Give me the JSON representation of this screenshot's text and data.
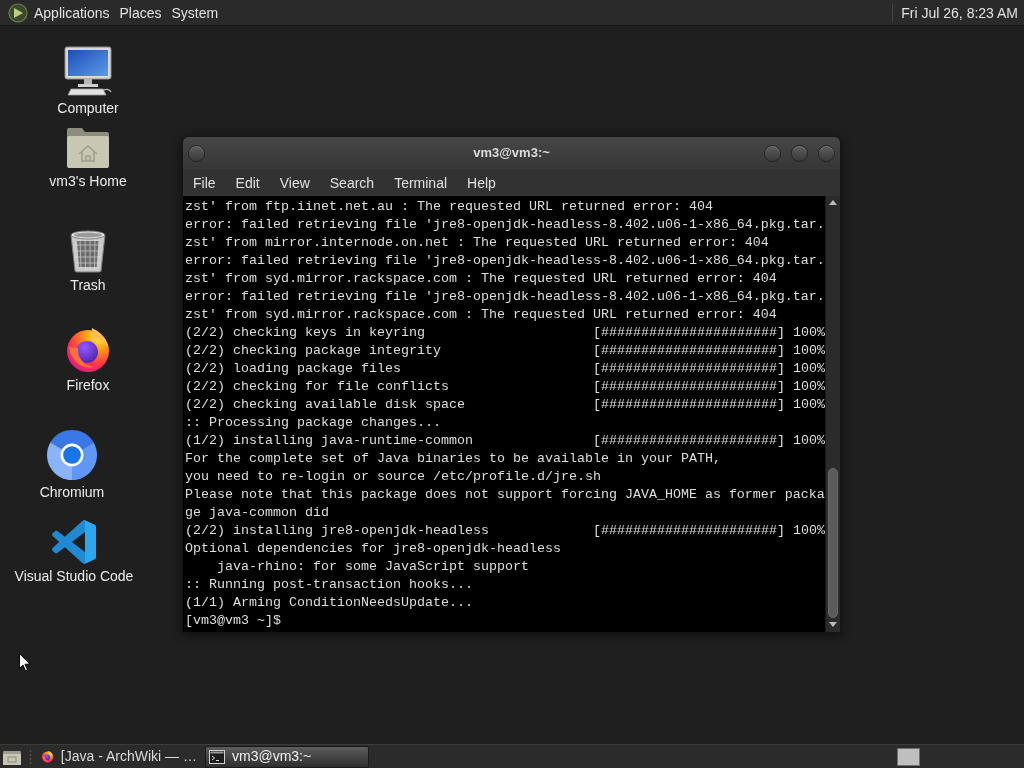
{
  "top_panel": {
    "menus": [
      "Applications",
      "Places",
      "System"
    ],
    "clock": "Fri Jul 26, 8:23 AM"
  },
  "desktop_icons": [
    {
      "kind": "computer",
      "label": "Computer"
    },
    {
      "kind": "home",
      "label": "vm3's Home"
    },
    {
      "kind": "trash",
      "label": "Trash"
    },
    {
      "kind": "firefox",
      "label": "Firefox"
    },
    {
      "kind": "chromium",
      "label": "Chromium"
    },
    {
      "kind": "vscode",
      "label": "Visual Studio Code"
    }
  ],
  "terminal": {
    "title": "vm3@vm3:~",
    "menu": [
      "File",
      "Edit",
      "View",
      "Search",
      "Terminal",
      "Help"
    ],
    "lines": [
      {
        "kind": "output",
        "text": "zst' from ftp.iinet.net.au : The requested URL returned error: 404"
      },
      {
        "kind": "output",
        "text": "error: failed retrieving file 'jre8-openjdk-headless-8.402.u06-1-x86_64.pkg.tar."
      },
      {
        "kind": "output",
        "text": "zst' from mirror.internode.on.net : The requested URL returned error: 404"
      },
      {
        "kind": "output",
        "text": "error: failed retrieving file 'jre8-openjdk-headless-8.402.u06-1-x86_64.pkg.tar."
      },
      {
        "kind": "output",
        "text": "zst' from syd.mirror.rackspace.com : The requested URL returned error: 404"
      },
      {
        "kind": "output",
        "text": "error: failed retrieving file 'jre8-openjdk-headless-8.402.u06-1-x86_64.pkg.tar."
      },
      {
        "kind": "output",
        "text": "zst' from syd.mirror.rackspace.com : The requested URL returned error: 404"
      },
      {
        "kind": "progress",
        "text": "(2/2) checking keys in keyring",
        "bar": "[######################]",
        "percent": "100%"
      },
      {
        "kind": "progress",
        "text": "(2/2) checking package integrity",
        "bar": "[######################]",
        "percent": "100%"
      },
      {
        "kind": "progress",
        "text": "(2/2) loading package files",
        "bar": "[######################]",
        "percent": "100%"
      },
      {
        "kind": "progress",
        "text": "(2/2) checking for file conflicts",
        "bar": "[######################]",
        "percent": "100%"
      },
      {
        "kind": "progress",
        "text": "(2/2) checking available disk space",
        "bar": "[######################]",
        "percent": "100%"
      },
      {
        "kind": "output",
        "text": ":: Processing package changes..."
      },
      {
        "kind": "progress",
        "text": "(1/2) installing java-runtime-common",
        "bar": "[######################]",
        "percent": "100%"
      },
      {
        "kind": "output",
        "text": "For the complete set of Java binaries to be available in your PATH,"
      },
      {
        "kind": "output",
        "text": "you need to re-login or source /etc/profile.d/jre.sh"
      },
      {
        "kind": "output",
        "text": "Please note that this package does not support forcing JAVA_HOME as former packa"
      },
      {
        "kind": "output",
        "text": "ge java-common did"
      },
      {
        "kind": "progress",
        "text": "(2/2) installing jre8-openjdk-headless",
        "bar": "[######################]",
        "percent": "100%"
      },
      {
        "kind": "output",
        "text": "Optional dependencies for jre8-openjdk-headless",
        "children": [
          {
            "kind": "output",
            "text": "java-rhino: for some JavaScript support"
          }
        ]
      },
      {
        "kind": "output",
        "text": ":: Running post-transaction hooks..."
      },
      {
        "kind": "output",
        "text": "(1/1) Arming ConditionNeedsUpdate..."
      },
      {
        "kind": "prompt",
        "text": "[vm3@vm3 ~]$"
      }
    ]
  },
  "taskbar": {
    "windows": [
      {
        "kind": "browser",
        "label": "[Java - ArchWiki — …",
        "selected": false
      },
      {
        "kind": "terminal",
        "label": "vm3@vm3:~",
        "selected": true
      }
    ]
  }
}
